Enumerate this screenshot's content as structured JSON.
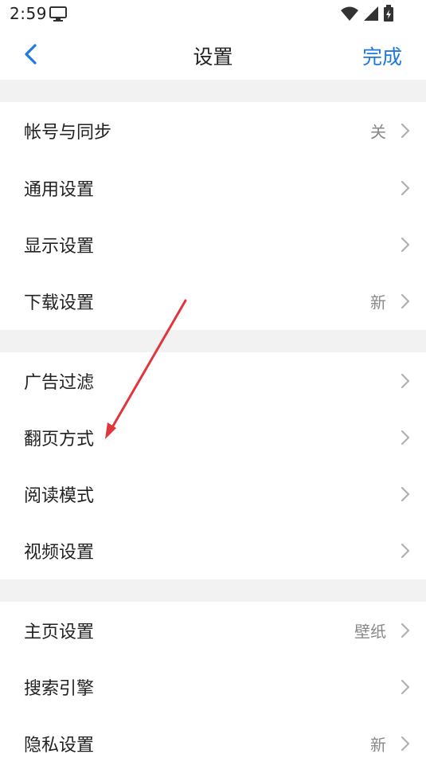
{
  "status_bar": {
    "time": "2:59",
    "icons": [
      "monitor-icon",
      "wifi-icon",
      "signal-icon",
      "battery-icon"
    ]
  },
  "nav": {
    "title": "设置",
    "done_label": "完成",
    "back_icon": "chevron-left-icon"
  },
  "colors": {
    "accent": "#1e7ae0",
    "separator": "#f2f2f2",
    "annotation_arrow": "#e0353a"
  },
  "sections": [
    {
      "items": [
        {
          "label": "帐号与同步",
          "value": "关"
        },
        {
          "label": "通用设置",
          "value": ""
        },
        {
          "label": "显示设置",
          "value": ""
        },
        {
          "label": "下载设置",
          "value": "新"
        }
      ]
    },
    {
      "items": [
        {
          "label": "广告过滤",
          "value": ""
        },
        {
          "label": "翻页方式",
          "value": ""
        },
        {
          "label": "阅读模式",
          "value": ""
        },
        {
          "label": "视频设置",
          "value": ""
        }
      ]
    },
    {
      "items": [
        {
          "label": "主页设置",
          "value": "壁纸"
        },
        {
          "label": "搜索引擎",
          "value": ""
        },
        {
          "label": "隐私设置",
          "value": "新"
        }
      ]
    }
  ]
}
